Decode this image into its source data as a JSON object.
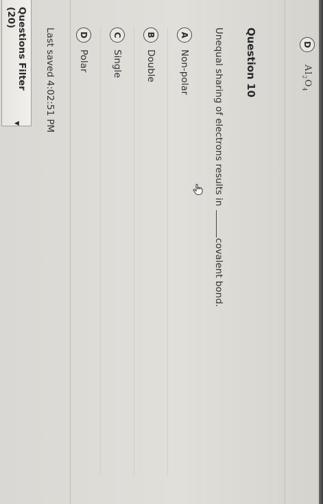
{
  "previous_question": {
    "option": {
      "letter": "D",
      "formula_main": "Al",
      "formula_sub1": "2",
      "formula_mid": "O",
      "formula_sub2": "4"
    }
  },
  "question": {
    "title": "Question 10",
    "text_before": "Unequal sharing of electrons results in",
    "text_after": "covalent bond.",
    "options": [
      {
        "letter": "A",
        "label": "Non-polar"
      },
      {
        "letter": "B",
        "label": "Double"
      },
      {
        "letter": "C",
        "label": "Single"
      },
      {
        "letter": "D",
        "label": "Polar"
      }
    ]
  },
  "footer": {
    "last_saved": "Last saved 4:02:51 PM",
    "filter_label": "Questions Filter (20)",
    "filter_caret": "▼"
  },
  "colors": {
    "background": "#dcdbd6",
    "text": "#2e2e2e",
    "divider": "#bdbcb6"
  }
}
